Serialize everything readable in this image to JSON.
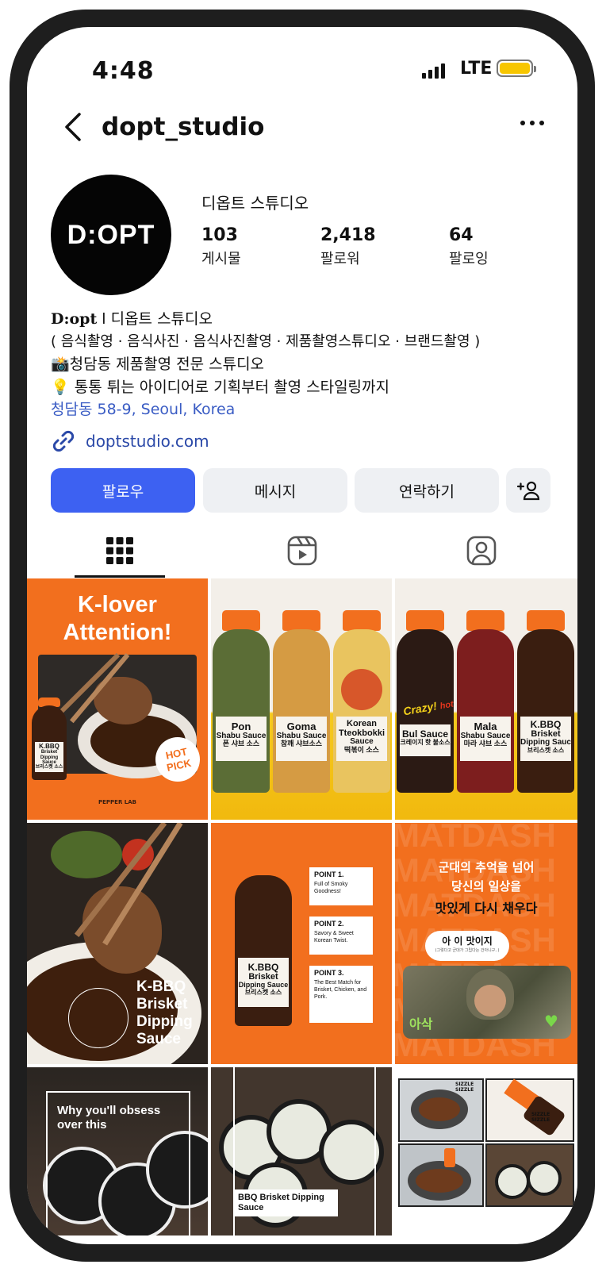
{
  "status_bar": {
    "time": "4:48",
    "network": "LTE"
  },
  "header": {
    "username": "dopt_studio"
  },
  "profile": {
    "avatar_text": "D:OPT",
    "display_name": "디옵트 스튜디오",
    "stats": [
      {
        "value": "103",
        "label": "게시물"
      },
      {
        "value": "2,418",
        "label": "팔로워"
      },
      {
        "value": "64",
        "label": "팔로잉"
      }
    ]
  },
  "bio": {
    "line1_bold": "D:opt",
    "line1_rest": " l 디옵트 스튜디오",
    "line2": "( 음식촬영 · 음식사진 · 음식사진촬영 · 제품촬영스튜디오 · 브랜드촬영 )",
    "line3_emoji": "📸",
    "line3": "청담동 제품촬영 전문 스튜디오",
    "line4_emoji": "💡",
    "line4": " 통통 튀는 아이디어로 기획부터 촬영 스타일링까지",
    "location": "청담동 58-9, Seoul, Korea",
    "website": "doptstudio.com"
  },
  "actions": {
    "follow": "팔로우",
    "message": "메시지",
    "contact": "연락하기"
  },
  "posts": {
    "p1": {
      "title1": "K-lover",
      "title2": "Attention!",
      "badge1": "HOT",
      "badge2": "PICK",
      "brand": "PEPPER LAB",
      "label1": "K.BBQ",
      "label2": "Brisket",
      "label3": "Dipping Sauce",
      "label4": "브리스켓 소스"
    },
    "p2": {
      "bottles": [
        {
          "name1": "Pon",
          "name2": "Shabu Sauce",
          "kr": "폰 샤브 소스"
        },
        {
          "name1": "Goma",
          "name2": "Shabu Sauce",
          "kr": "참깨 샤브소스"
        },
        {
          "name1": "Korean",
          "name2": "Tteokbokki",
          "name3": "Sauce",
          "kr": "떡볶이 소스"
        }
      ]
    },
    "p3": {
      "bottles": [
        {
          "badge": "Crazy!",
          "badge2": "hot",
          "name1": "Bul Sauce",
          "kr": "크레이지 핫 불소스"
        },
        {
          "name1": "Mala",
          "name2": "Shabu Sauce",
          "kr": "마라 샤브 소스"
        },
        {
          "name1": "K.BBQ",
          "name2": "Brisket",
          "name3": "Dipping Sauc",
          "kr": "브리스켓 소스"
        }
      ]
    },
    "p4": {
      "l1": "K-BBQ",
      "l2": "Brisket",
      "l3": "Dipping",
      "l4": "Sauce"
    },
    "p5": {
      "bottle_label1": "K.BBQ",
      "bottle_label2": "Brisket",
      "bottle_label3": "Dipping Sauce",
      "bottle_label4": "브리스켓 소스",
      "points": [
        {
          "title": "POINT 1.",
          "text": "Full of Smoky Goodness!"
        },
        {
          "title": "POINT 2.",
          "text": "Savory & Sweet Korean Twist."
        },
        {
          "title": "POINT 3.",
          "text": "The Best Match for Brisket, Chicken, and Pork."
        }
      ]
    },
    "p6": {
      "bg_text": "MATDASH",
      "line1": "군대의 추억을 넘어",
      "line2": "당신의 일상을",
      "line3": "맛있게 다시 채우다",
      "bubble1": "아 이 맛이지",
      "bubble2": "(그렇다고 군대가 그립다는 건아니구..)",
      "caption": "아삭"
    },
    "p7": {
      "text": "Why you'll obsess over this"
    },
    "p8": {
      "text": "BBQ Brisket Dipping Sauce"
    },
    "p9": {
      "sfx1": "SIZZLE SIZZLE",
      "sfx2": "SIZZLE SIZZLE"
    }
  },
  "colors": {
    "accent": "#3d61f2",
    "orange": "#f26f1e",
    "link": "#2b49a8"
  }
}
